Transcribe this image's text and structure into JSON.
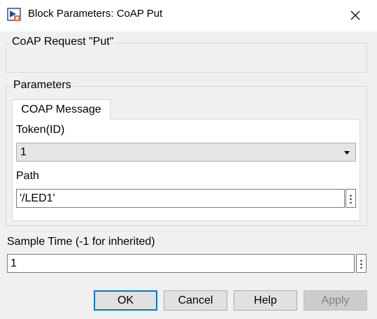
{
  "window": {
    "title": "Block Parameters: CoAP Put",
    "app_icon": "simulink-block-icon",
    "close_icon": "close-icon"
  },
  "description_group": {
    "title": "CoAP Request \"Put\""
  },
  "parameters_group": {
    "title": "Parameters",
    "tabs": [
      {
        "label": "COAP Message",
        "selected": true
      }
    ],
    "token": {
      "label": "Token(ID)",
      "value": "1"
    },
    "path": {
      "label": "Path",
      "value": "'/LED1'",
      "more_icon": "vertical-ellipsis-icon"
    }
  },
  "sample_time": {
    "label": "Sample Time (-1 for inherited)",
    "value": "1",
    "more_icon": "vertical-ellipsis-icon"
  },
  "buttons": {
    "ok": "OK",
    "cancel": "Cancel",
    "help": "Help",
    "apply": "Apply"
  },
  "colors": {
    "dialog_bg": "#f0f0f0",
    "default_button_border": "#0078d7",
    "disabled_button_text": "#838383"
  }
}
